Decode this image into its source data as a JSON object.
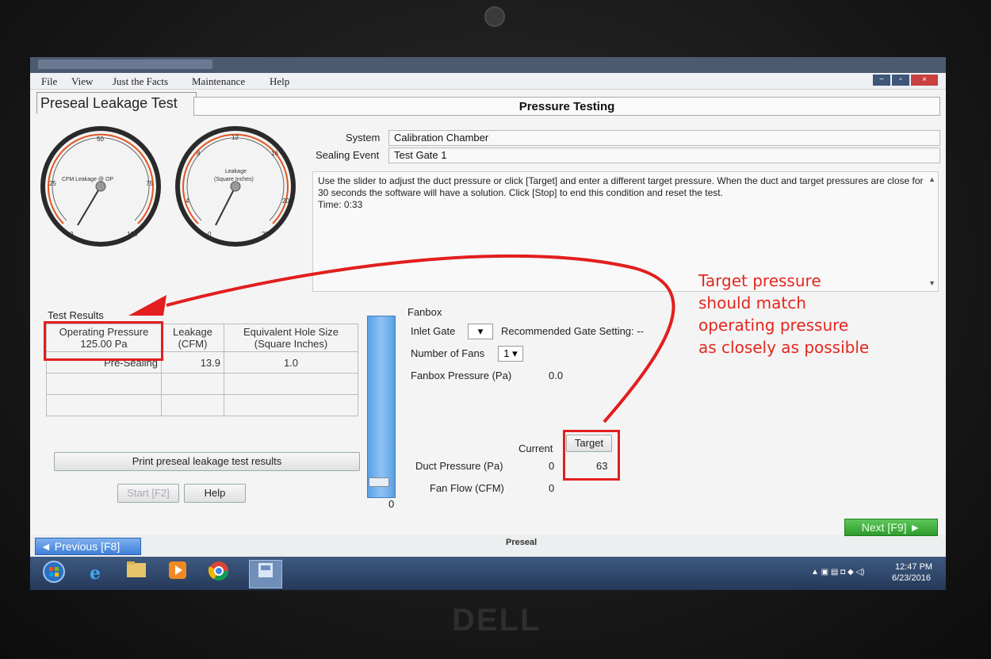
{
  "menu": [
    "File",
    "View",
    "Just the Facts",
    "Maintenance",
    "Help"
  ],
  "page_tab": "Preseal Leakage Test",
  "header_title": "Pressure Testing",
  "gauges": {
    "left": {
      "label": "CFM Leakage @ OP",
      "ticks": [
        "0",
        "25",
        "50",
        "75",
        "100"
      ]
    },
    "right": {
      "label_line1": "Leakage",
      "label_line2": "(Square Inches)",
      "ticks": [
        "0",
        "4",
        "8",
        "12",
        "16",
        "20",
        "25"
      ]
    }
  },
  "system_label": "System",
  "system_value": "Calibration Chamber",
  "sealing_label": "Sealing Event",
  "sealing_value": "Test Gate 1",
  "instructions": "Use the slider to adjust the duct pressure or click [Target] and enter a different target pressure.  When the duct and target pressures are close for 30 seconds the software will have a solution. Click [Stop] to end this condition and reset the test.",
  "time_text": "Time: 0:33",
  "test_results": {
    "label": "Test Results",
    "headers": {
      "op_pressure_line1": "Operating Pressure",
      "op_pressure_line2": "125.00 Pa",
      "leakage_line1": "Leakage",
      "leakage_line2": "(CFM)",
      "hole_line1": "Equivalent Hole Size",
      "hole_line2": "(Square Inches)"
    },
    "rows": [
      {
        "name": "Pre-Sealing",
        "leakage": "13.9",
        "hole": "1.0"
      }
    ]
  },
  "print_button": "Print preseal leakage test results",
  "start_button": "Start [F2]",
  "help_button": "Help",
  "slider_value": "0",
  "fanbox": {
    "title": "Fanbox",
    "inlet_gate_label": "Inlet Gate",
    "recommended": "Recommended Gate Setting: --",
    "num_fans_label": "Number of Fans",
    "num_fans_value": "1",
    "fanbox_pressure_label": "Fanbox Pressure (Pa)",
    "fanbox_pressure_value": "0.0"
  },
  "pressure_table": {
    "current_label": "Current",
    "target_button": "Target",
    "duct_label": "Duct Pressure (Pa)",
    "duct_current": "0",
    "duct_target": "63",
    "fan_flow_label": "Fan Flow (CFM)",
    "fan_flow_current": "0"
  },
  "previous_button": "◄ Previous [F8]",
  "next_button": "Next [F9] ►",
  "center_label": "Preseal",
  "tray": {
    "time": "12:47 PM",
    "date": "6/23/2016"
  },
  "annotation": [
    "Target pressure",
    "should match",
    "operating pressure",
    "as closely as possible"
  ],
  "colors": {
    "annotation": "#e21e1e",
    "next": "#2e9b2c",
    "previous": "#3f7fd6",
    "slider": "#5aa0e6"
  }
}
